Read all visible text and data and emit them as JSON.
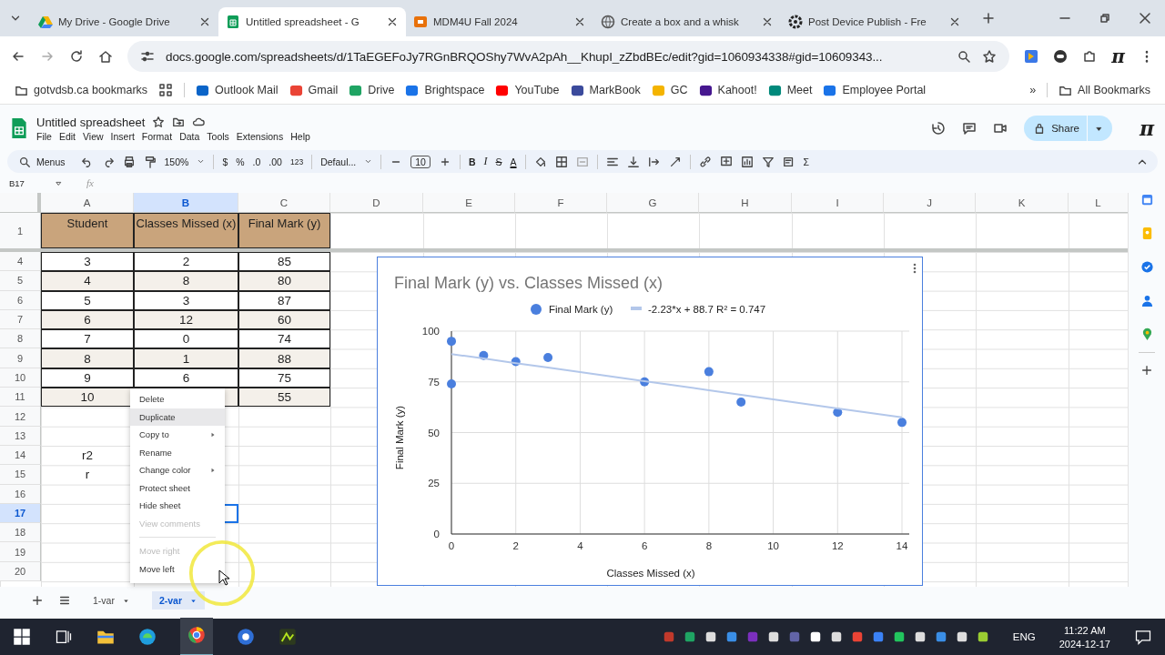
{
  "browser": {
    "tabs": [
      {
        "title": "My Drive - Google Drive",
        "selected": false
      },
      {
        "title": "Untitled spreadsheet - G",
        "selected": true
      },
      {
        "title": "MDM4U Fall 2024",
        "selected": false
      },
      {
        "title": "Create a box and a whisk",
        "selected": false
      },
      {
        "title": "Post Device Publish - Fre",
        "selected": false
      }
    ],
    "address": "docs.google.com/spreadsheets/d/1TaEGEFoJy7RGnBRQOShy7WvA2pAh__KhupI_zZbdBEc/edit?gid=1060934338#gid=10609343...",
    "bookmarks": [
      {
        "label": "gotvdsb.ca bookmarks"
      },
      {
        "label": "Outlook Mail"
      },
      {
        "label": "Gmail"
      },
      {
        "label": "Drive"
      },
      {
        "label": "Brightspace"
      },
      {
        "label": "YouTube"
      },
      {
        "label": "MarkBook"
      },
      {
        "label": "GC"
      },
      {
        "label": "Kahoot!"
      },
      {
        "label": "Meet"
      },
      {
        "label": "Employee Portal"
      }
    ],
    "more_bookmarks": "»",
    "all_bookmarks": "All Bookmarks",
    "extension_logo": "π"
  },
  "doc": {
    "title": "Untitled spreadsheet",
    "menus": [
      "File",
      "Edit",
      "View",
      "Insert",
      "Format",
      "Data",
      "Tools",
      "Extensions",
      "Help"
    ],
    "share": "Share",
    "logo": "π"
  },
  "toolbar": {
    "menus_search": "Menus",
    "zoom": "150%",
    "currency": "$",
    "percent": "%",
    "decrease_decimals": ".0",
    "increase_decimals": ".00",
    "number_format": "123",
    "font": "Defaul...",
    "font_size": "10",
    "bold": "B",
    "italic": "I",
    "strikethrough": "S",
    "text_color": "A",
    "functions": "Σ"
  },
  "name_box": "B17",
  "formula_label": "fx",
  "columns": [
    {
      "label": "A",
      "selected": false
    },
    {
      "label": "B",
      "selected": true
    },
    {
      "label": "C",
      "selected": false
    },
    {
      "label": "D",
      "selected": false
    },
    {
      "label": "E",
      "selected": false
    },
    {
      "label": "F",
      "selected": false
    },
    {
      "label": "G",
      "selected": false
    },
    {
      "label": "H",
      "selected": false
    },
    {
      "label": "I",
      "selected": false
    },
    {
      "label": "J",
      "selected": false
    },
    {
      "label": "K",
      "selected": false
    },
    {
      "label": "L",
      "selected": false
    }
  ],
  "rows": [
    {
      "number": "1",
      "kind": "header",
      "selected": false,
      "A": "Student",
      "B": "Classes Missed (x)",
      "C": "Final Mark (y)"
    },
    {
      "number": "4",
      "kind": "data",
      "shaded": false,
      "selected": false,
      "A": "3",
      "B": "2",
      "C": "85"
    },
    {
      "number": "5",
      "kind": "data",
      "shaded": true,
      "selected": false,
      "A": "4",
      "B": "8",
      "C": "80"
    },
    {
      "number": "6",
      "kind": "data",
      "shaded": false,
      "selected": false,
      "A": "5",
      "B": "3",
      "C": "87"
    },
    {
      "number": "7",
      "kind": "data",
      "shaded": true,
      "selected": false,
      "A": "6",
      "B": "12",
      "C": "60"
    },
    {
      "number": "8",
      "kind": "data",
      "shaded": false,
      "selected": false,
      "A": "7",
      "B": "0",
      "C": "74"
    },
    {
      "number": "9",
      "kind": "data",
      "shaded": true,
      "selected": false,
      "A": "8",
      "B": "1",
      "C": "88"
    },
    {
      "number": "10",
      "kind": "data",
      "shaded": false,
      "selected": false,
      "A": "9",
      "B": "6",
      "C": "75"
    },
    {
      "number": "11",
      "kind": "data",
      "shaded": true,
      "selected": false,
      "A": "10",
      "C": "55"
    },
    {
      "number": "12",
      "kind": "empty",
      "selected": false
    },
    {
      "number": "13",
      "kind": "empty",
      "selected": false
    },
    {
      "number": "14",
      "kind": "empty",
      "selected": false,
      "A": "r2"
    },
    {
      "number": "15",
      "kind": "empty",
      "selected": false,
      "A": "r"
    },
    {
      "number": "16",
      "kind": "empty",
      "selected": false
    },
    {
      "number": "17",
      "kind": "empty",
      "selected": true
    },
    {
      "number": "18",
      "kind": "empty",
      "selected": false
    },
    {
      "number": "19",
      "kind": "empty",
      "selected": false
    },
    {
      "number": "20",
      "kind": "empty",
      "selected": false
    }
  ],
  "chart": {
    "chart_data": {
      "type": "scatter",
      "title": "Final Mark (y) vs. Classes Missed (x)",
      "xlabel": "Classes Missed (x)",
      "ylabel": "Final Mark (y)",
      "x": [
        0,
        0,
        1,
        2,
        3,
        6,
        8,
        9,
        12,
        14
      ],
      "series": [
        {
          "name": "Final Mark (y)",
          "color": "#4a7fde",
          "values": [
            95,
            74,
            88,
            85,
            87,
            75,
            80,
            65,
            60,
            55
          ]
        },
        {
          "name": "-2.23*x + 88.7 R² = 0.747",
          "color": "#b3c7ea",
          "type": "line",
          "values": [
            88.7,
            88.7,
            86.5,
            84.2,
            82.0,
            75.3,
            70.9,
            68.6,
            61.9,
            57.5
          ]
        }
      ],
      "xlim": [
        0,
        14
      ],
      "ylim": [
        0,
        100
      ],
      "grid": true,
      "legend": true,
      "xticks": [
        {
          "value": 0,
          "label": "0"
        },
        {
          "value": 2,
          "label": "2"
        },
        {
          "value": 4,
          "label": "4"
        },
        {
          "value": 6,
          "label": "6"
        },
        {
          "value": 8,
          "label": "8"
        },
        {
          "value": 10,
          "label": "10"
        },
        {
          "value": 12,
          "label": "12"
        },
        {
          "value": 14,
          "label": "14"
        }
      ],
      "yticks": [
        {
          "value": 0,
          "label": "0"
        },
        {
          "value": 25,
          "label": "25"
        },
        {
          "value": 50,
          "label": "50"
        },
        {
          "value": 75,
          "label": "75"
        },
        {
          "value": 100,
          "label": "100"
        }
      ]
    }
  },
  "context_menu": [
    {
      "kind": "item",
      "label": "Delete",
      "disabled": false,
      "submenu": false,
      "selected": false
    },
    {
      "kind": "item",
      "label": "Duplicate",
      "disabled": false,
      "submenu": false,
      "selected": true
    },
    {
      "kind": "item",
      "label": "Copy to",
      "disabled": false,
      "submenu": true,
      "selected": false
    },
    {
      "kind": "item",
      "label": "Rename",
      "disabled": false,
      "submenu": false,
      "selected": false
    },
    {
      "kind": "item",
      "label": "Change color",
      "disabled": false,
      "submenu": true,
      "selected": false
    },
    {
      "kind": "item",
      "label": "Protect sheet",
      "disabled": false,
      "submenu": false,
      "selected": false
    },
    {
      "kind": "item",
      "label": "Hide sheet",
      "disabled": false,
      "submenu": false,
      "selected": false
    },
    {
      "kind": "item",
      "label": "View comments",
      "disabled": true,
      "submenu": false,
      "selected": false
    },
    {
      "kind": "divider"
    },
    {
      "kind": "item",
      "label": "Move right",
      "disabled": true,
      "submenu": false,
      "selected": false
    },
    {
      "kind": "item",
      "label": "Move left",
      "disabled": false,
      "submenu": false,
      "selected": false
    }
  ],
  "sheet_tabs": [
    {
      "label": "1-var",
      "selected": false
    },
    {
      "label": "2-var",
      "selected": true
    }
  ],
  "taskbar": {
    "language": "ENG",
    "time": "11:22 AM",
    "date": "2024-12-17"
  }
}
